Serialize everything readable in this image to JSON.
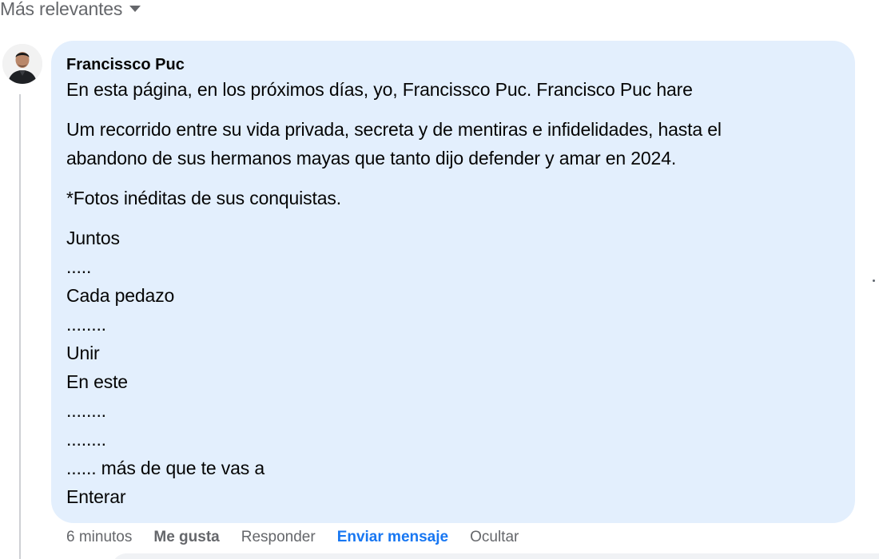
{
  "sort": {
    "label": "Más relevantes",
    "icon": "caret-down-icon"
  },
  "comment": {
    "author": "Francissco Puc",
    "avatar_icon": "profile-photo",
    "paragraphs": [
      [
        "En esta página, en los próximos días, yo, Francissco Puc. Francisco Puc hare"
      ],
      [
        "Um recorrido entre su vida privada, secreta y de mentiras e infidelidades, hasta el",
        "abandono de sus hermanos mayas que tanto dijo defender y amar en 2024."
      ],
      [
        "*Fotos inéditas de sus conquistas."
      ],
      [
        "Juntos",
        ".....",
        "Cada pedazo",
        "........",
        "Unir",
        "En este",
        "........",
        "........",
        "...... más de que te vas a",
        "Enterar"
      ]
    ],
    "bubble_color": "#e3effd"
  },
  "actions": {
    "time": "6 minutos",
    "like": "Me gusta",
    "reply": "Responder",
    "send_message": "Enviar mensaje",
    "hide": "Ocultar",
    "send_message_color": "#1877f2"
  }
}
